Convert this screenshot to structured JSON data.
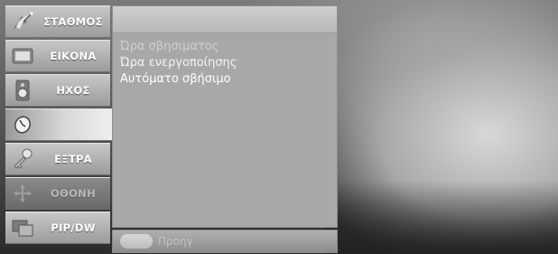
{
  "sidebar": {
    "items": [
      {
        "label": "ΣΤΑΘΜΟΣ",
        "icon": "satellite-dish-icon"
      },
      {
        "label": "ΕΙΚΟΝΑ",
        "icon": "screen-icon"
      },
      {
        "label": "ΗΧΟΣ",
        "icon": "speaker-icon"
      },
      {
        "label": "",
        "icon": "clock-icon"
      },
      {
        "label": "ΕΞΤΡΑ",
        "icon": "key-icon"
      },
      {
        "label": "ΟΘΟΝΗ",
        "icon": "move-arrows-icon"
      },
      {
        "label": "PIP/DW",
        "icon": "pip-icon"
      }
    ]
  },
  "panel": {
    "options": [
      "Ώρα σβησιματος",
      "Ώρα ενεργοποίησης",
      "Αυτόματο σβήσιμο"
    ]
  },
  "footer": {
    "label": "Προηγ"
  }
}
